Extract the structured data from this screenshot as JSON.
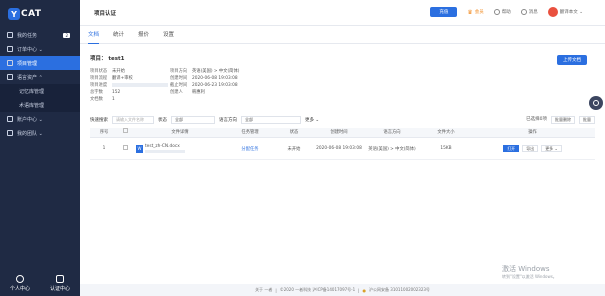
{
  "brand": {
    "logo_y": "Y",
    "logo_text": "CAT"
  },
  "sidebar": {
    "items": [
      {
        "label": "我的任务",
        "badge": "2"
      },
      {
        "label": "订单中心 ⌄"
      },
      {
        "label": "项目管理"
      },
      {
        "label": "语言资产 ⌃"
      },
      {
        "label": "记忆库管理"
      },
      {
        "label": "术语库管理"
      },
      {
        "label": "账户中心 ⌄"
      },
      {
        "label": "我的团队 ⌄"
      }
    ],
    "footer": {
      "personal": "个人中心",
      "cert": "认证中心"
    }
  },
  "topbar": {
    "breadcrumb": "项目认证",
    "button": "充值",
    "vip": "会员",
    "help": "帮助",
    "messages": "消息",
    "user": "翻译本文 ⌄"
  },
  "tabs": [
    "文档",
    "统计",
    "报价",
    "设置"
  ],
  "project": {
    "title": "项目： test1",
    "upload_button": "上传文档",
    "info": [
      {
        "k": "项目状态",
        "v": "未开始",
        "k2": "项目方向",
        "v2": "英语(美国) > 中文(简体)"
      },
      {
        "k": "项目流程",
        "v": "翻译+审校",
        "k2": "创建时间",
        "v2": "2020-06-08 19:03:08"
      },
      {
        "k": "项目进度",
        "v": "",
        "k2": "截止时间",
        "v2": "2020-06-23 19:03:08"
      },
      {
        "k": "总字数",
        "v": "152",
        "k2": "创建人",
        "v2": "韩惠利"
      },
      {
        "k": "文档数",
        "v": "1",
        "k2": "",
        "v2": ""
      }
    ]
  },
  "filters": {
    "search_label": "快速搜索",
    "search_placeholder": "请输入文件名称",
    "status_label": "状态",
    "status_value": "全部",
    "direction_label": "语言方向",
    "direction_value": "全部",
    "more": "更多 ⌄",
    "right_buttons": [
      "已选择0项",
      "批量删除",
      "批量"
    ]
  },
  "table": {
    "headers": [
      "序号",
      "",
      "文件详情",
      "任务管理",
      "状态",
      "创建时间",
      "语言方向",
      "文件大小",
      "操作"
    ],
    "rows": [
      {
        "index": "1",
        "file_icon": "W",
        "file_name": "test_zh-CN.docx",
        "task": "分配任务",
        "status": "未开始",
        "created": "2020-06-08 19:03:08",
        "direction": "英语(美国) > 中文(简体)",
        "size": "15KB",
        "ops": [
          "打开",
          "导出",
          "更多 ⌄"
        ]
      }
    ]
  },
  "footer": {
    "left": "关于 一者",
    "middle": "©2020 一者科技 沪ICP备14017097号-1",
    "right": "沪公网安备 31011002002323号"
  },
  "watermark": {
    "line1": "激活 Windows",
    "line2": "转到\"设置\"以激活 Windows。"
  }
}
